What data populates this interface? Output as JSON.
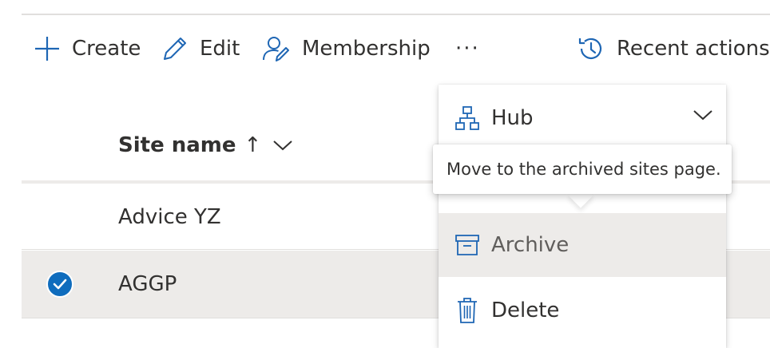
{
  "toolbar": {
    "create_label": "Create",
    "edit_label": "Edit",
    "membership_label": "Membership",
    "more_label": "···",
    "recent_actions_label": "Recent actions"
  },
  "table": {
    "columns": {
      "site_name": "Site name",
      "sort_indicator": "↑"
    },
    "rows": [
      {
        "name": "Advice YZ",
        "selected": false
      },
      {
        "name": "AGGP",
        "selected": true
      }
    ]
  },
  "context_menu": {
    "items": [
      {
        "label": "Hub",
        "icon": "hub-icon",
        "has_submenu": true
      },
      {
        "label": "Archive",
        "icon": "archive-icon",
        "hovered": true
      },
      {
        "label": "Delete",
        "icon": "trash-icon"
      }
    ]
  },
  "tooltip": {
    "text": "Move to the archived sites page."
  },
  "colors": {
    "accent": "#0f6cbd",
    "icon_blue": "#1e66b4",
    "text": "#323130",
    "selected_row": "#edebe9",
    "divider": "#e1dfdd"
  }
}
